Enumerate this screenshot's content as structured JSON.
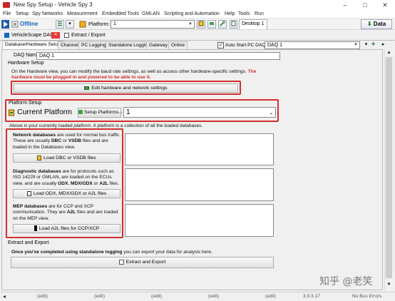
{
  "window": {
    "title": "New Spy Setup - Vehicle Spy 3",
    "controls": [
      "–",
      "□",
      "✕"
    ]
  },
  "menu": [
    "File",
    "Setup",
    "Spy Networks",
    "Measurement",
    "Embedded Tools",
    "GMLAN",
    "Scripting and Automation",
    "Help",
    "Tools",
    "Run"
  ],
  "toolbar": {
    "status": "Offline",
    "platform_label": "Platform:",
    "platform_value": "1",
    "desktop_tab": "Desktop 1",
    "data_button": "Data"
  },
  "doc_tabs": [
    "VehicleScape DAQ",
    "Extract / Export"
  ],
  "sub_tabs": [
    "Database/Hardware Setup",
    "Channels",
    "PC Logging",
    "Standalone Logging",
    "Gateway",
    "Online"
  ],
  "auto_start": {
    "label": "Auto Start PC DAQ",
    "checked": true,
    "select_value": "DAQ 1"
  },
  "daq_name": {
    "label": "DAQ Name",
    "value": "DAQ 1"
  },
  "hardware": {
    "heading": "Hardware Setup",
    "text": "On the Hardware view, you can modify the baud rate settings, as well as access other hardware-specific settings.",
    "warning": "The hardware must be plugged in and powered to be able to use it.",
    "button": "Edit hardware and network settings"
  },
  "platform": {
    "heading": "Platform Setup",
    "title": "Current Platform",
    "button": "Setup Platforms...",
    "value": "1",
    "note_pre": "Above is your currently loaded ",
    "note_em": "platform",
    "note_post": ". A platform is a collection of all the loaded databases."
  },
  "databases": {
    "network": {
      "title": "Network databases",
      "t1": " are used for normal bus traffic. These are usually ",
      "b1": "DBC",
      "t2": " or ",
      "b2": "VSDB",
      "t3": " files and are loaded in the Databases view.",
      "button": "Load DBC or VSDB files"
    },
    "diagnostic": {
      "title": "Diagnostic databases",
      "t1": " are for protocols such as ISO 14229 or GMLAN, are loaded on the ECUs view, and are usually ",
      "b1": "ODX",
      "t2": ", ",
      "b2": "MDX/GDX",
      "t3": " or ",
      "b3": "A2L",
      "t4": " files.",
      "button": "Load ODX, MDX/GDX or A2L files"
    },
    "mep": {
      "title": "MEP databases",
      "t1": " are for CCP and XCP communication. They are ",
      "b1": "A2L",
      "t2": " files and are loaded on the MEP view.",
      "button": "Load A2L files for CCP/XCP"
    }
  },
  "extract": {
    "heading": "Extract and Export",
    "text_b": "Once you've completed using standalone logging",
    "text": " you can export your data for analysis here.",
    "button": "Extract and Export"
  },
  "status": {
    "fields": [
      "(edit)",
      "(edit)",
      "(edit)",
      "(edit)",
      "(edit)"
    ],
    "version": "3.9.3.17",
    "bus": "No Bus Errors"
  },
  "watermark": "知乎 @老笑",
  "colors": {
    "highlight": "#d32f2f",
    "offline": "#1565c0",
    "warning": "#d32f2f"
  }
}
